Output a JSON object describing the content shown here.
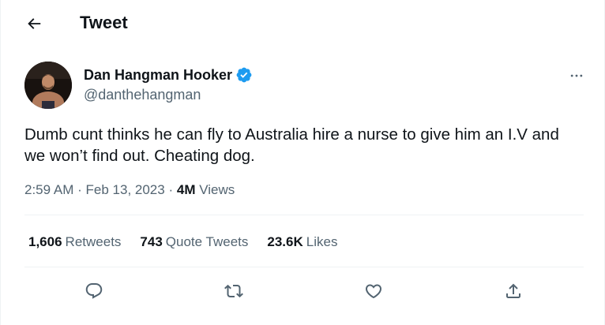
{
  "header": {
    "title": "Tweet",
    "back_icon": "arrow-left-icon"
  },
  "author": {
    "name": "Dan Hangman Hooker",
    "handle": "@danthehangman",
    "verified": true,
    "verified_color": "#1d9bf0"
  },
  "tweet": {
    "text": "Dumb cunt thinks he can fly to Australia hire a nurse to give him an I.V and we won’t find out. Cheating dog.",
    "time": "2:59 AM",
    "date": "Feb 13, 2023",
    "separator": "·",
    "views_count": "4M",
    "views_label": "Views"
  },
  "stats": {
    "retweets_count": "1,606",
    "retweets_label": "Retweets",
    "quotes_count": "743",
    "quotes_label": "Quote Tweets",
    "likes_count": "23.6K",
    "likes_label": "Likes"
  },
  "actions": [
    "reply-icon",
    "retweet-icon",
    "like-icon",
    "share-icon"
  ],
  "colors": {
    "text": "#0f1419",
    "secondary": "#536471",
    "border": "#eff3f4",
    "accent": "#1d9bf0"
  }
}
